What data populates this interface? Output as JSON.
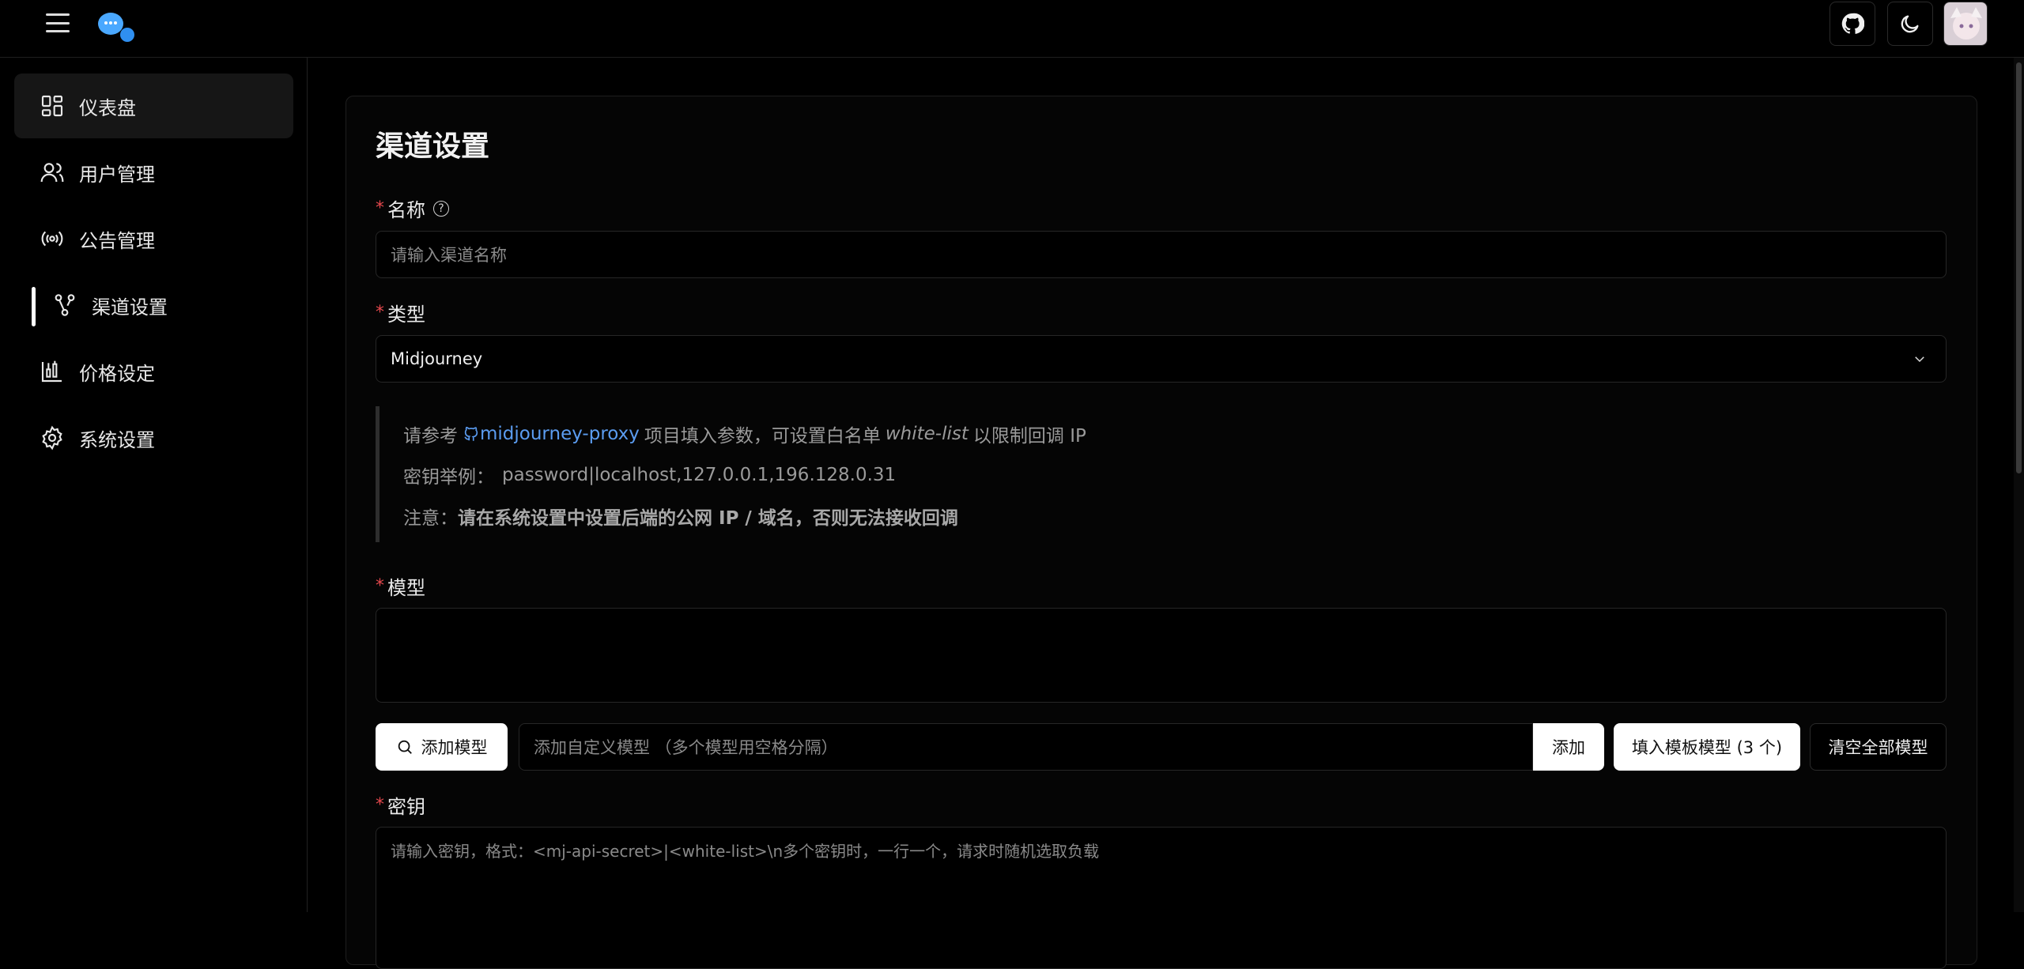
{
  "sidebar": {
    "items": [
      {
        "label": "仪表盘",
        "icon": "dashboard-icon"
      },
      {
        "label": "用户管理",
        "icon": "users-icon"
      },
      {
        "label": "公告管理",
        "icon": "broadcast-icon"
      },
      {
        "label": "渠道设置",
        "icon": "channel-icon",
        "active": true
      },
      {
        "label": "价格设定",
        "icon": "pricing-icon"
      },
      {
        "label": "系统设置",
        "icon": "settings-icon"
      }
    ]
  },
  "header": {
    "icons": [
      "menu-icon",
      "logo-icon",
      "github-icon",
      "moon-icon",
      "avatar"
    ]
  },
  "form": {
    "title": "渠道设置",
    "name": {
      "label": "名称",
      "placeholder": "请输入渠道名称"
    },
    "type": {
      "label": "类型",
      "value": "Midjourney"
    },
    "note": {
      "line1_prefix": "请参考",
      "line1_link": "midjourney-proxy",
      "line1_mid": "项目填入参数，可设置白名单",
      "line1_em": "white-list",
      "line1_suffix": "以限制回调 IP",
      "line2_label": "密钥举例：",
      "line2_value": "password|localhost,127.0.0.1,196.128.0.31",
      "line3_label": "注意：",
      "line3_strong": "请在系统设置中设置后端的公网 IP / 域名，否则无法接收回调"
    },
    "model": {
      "label": "模型",
      "add_button": "添加模型",
      "custom_placeholder": "添加自定义模型 （多个模型用空格分隔）",
      "add_custom_button": "添加",
      "fill_template_button": "填入模板模型 (3 个)",
      "clear_all_button": "清空全部模型"
    },
    "key": {
      "label": "密钥",
      "placeholder": "请输入密钥，格式：<mj-api-secret>|<white-list>\\n多个密钥时，一行一个，请求时随机选取负载"
    }
  },
  "colors": {
    "accent_link": "#5b9cf0",
    "required": "#e5484d",
    "background": "#000000"
  }
}
